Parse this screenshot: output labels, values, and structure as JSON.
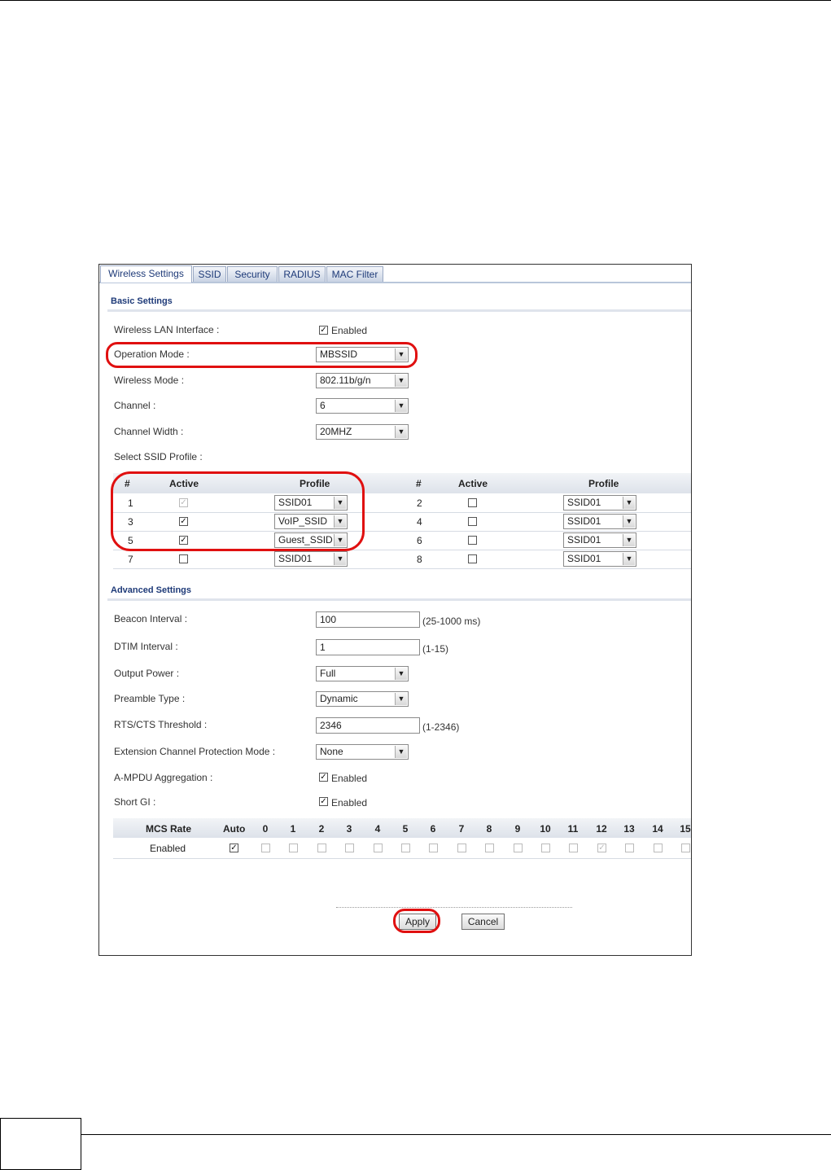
{
  "tabs": [
    {
      "label": "Wireless Settings",
      "active": true
    },
    {
      "label": "SSID",
      "active": false
    },
    {
      "label": "Security",
      "active": false
    },
    {
      "label": "RADIUS",
      "active": false
    },
    {
      "label": "MAC Filter",
      "active": false
    }
  ],
  "basic": {
    "title": "Basic Settings",
    "wlan_label": "Wireless LAN Interface :",
    "wlan_enabled": "Enabled",
    "opmode_label": "Operation Mode :",
    "opmode_value": "MBSSID",
    "wmode_label": "Wireless Mode :",
    "wmode_value": "802.11b/g/n",
    "channel_label": "Channel :",
    "channel_value": "6",
    "width_label": "Channel Width :",
    "width_value": "20MHZ",
    "ssid_profile_label": "Select SSID Profile :"
  },
  "ssid_table": {
    "headers": {
      "num": "#",
      "active": "Active",
      "profile": "Profile"
    },
    "rows": [
      {
        "left_num": "1",
        "left_active": true,
        "left_disabled": true,
        "left_profile": "SSID01",
        "right_num": "2",
        "right_active": false,
        "right_profile": "SSID01"
      },
      {
        "left_num": "3",
        "left_active": true,
        "left_disabled": false,
        "left_profile": "VoIP_SSID",
        "right_num": "4",
        "right_active": false,
        "right_profile": "SSID01"
      },
      {
        "left_num": "5",
        "left_active": true,
        "left_disabled": false,
        "left_profile": "Guest_SSID",
        "right_num": "6",
        "right_active": false,
        "right_profile": "SSID01"
      },
      {
        "left_num": "7",
        "left_active": false,
        "left_disabled": false,
        "left_profile": "SSID01",
        "right_num": "8",
        "right_active": false,
        "right_profile": "SSID01"
      }
    ]
  },
  "advanced": {
    "title": "Advanced Settings",
    "beacon_label": "Beacon Interval :",
    "beacon_value": "100",
    "beacon_hint": "(25-1000 ms)",
    "dtim_label": "DTIM Interval :",
    "dtim_value": "1",
    "dtim_hint": "(1-15)",
    "power_label": "Output Power :",
    "power_value": "Full",
    "preamble_label": "Preamble Type :",
    "preamble_value": "Dynamic",
    "rts_label": "RTS/CTS Threshold :",
    "rts_value": "2346",
    "rts_hint": "(1-2346)",
    "ext_label": "Extension Channel Protection Mode :",
    "ext_value": "None",
    "ampdu_label": "A-MPDU Aggregation :",
    "ampdu_enabled": "Enabled",
    "shortgi_label": "Short GI :",
    "shortgi_enabled": "Enabled"
  },
  "mcs": {
    "rate_label": "MCS Rate",
    "row_label": "Enabled",
    "auto_label": "Auto",
    "auto_checked": true,
    "columns": [
      "0",
      "1",
      "2",
      "3",
      "4",
      "5",
      "6",
      "7",
      "8",
      "9",
      "10",
      "11",
      "12",
      "13",
      "14",
      "15"
    ],
    "checked_index": 12
  },
  "buttons": {
    "apply": "Apply",
    "cancel": "Cancel"
  },
  "colors": {
    "highlight": "#e01010",
    "section_title": "#1e3a78"
  }
}
